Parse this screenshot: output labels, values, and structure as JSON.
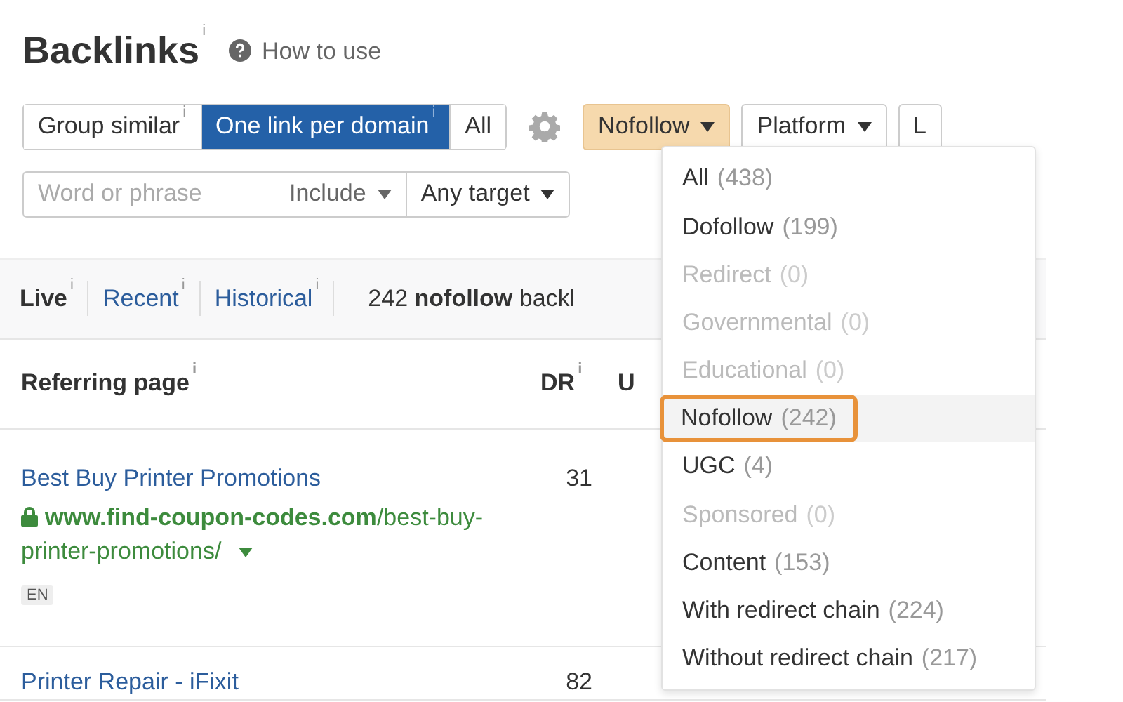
{
  "header": {
    "title": "Backlinks",
    "title_info": "i",
    "help_link": "How to use"
  },
  "mode_toggle": [
    {
      "label": "Group similar",
      "info": "i",
      "selected": false
    },
    {
      "label": "One link per domain",
      "info": "i",
      "selected": true
    },
    {
      "label": "All",
      "selected": false
    }
  ],
  "filters": [
    {
      "label": "Nofollow",
      "active": true
    },
    {
      "label": "Platform",
      "active": false
    },
    {
      "label": "L",
      "active": false
    }
  ],
  "search": {
    "placeholder": "Word or phrase",
    "mode": "Include",
    "target": "Any target"
  },
  "history_tabs": [
    {
      "label": "Live",
      "info": "i",
      "selected": true
    },
    {
      "label": "Recent",
      "info": "i",
      "selected": false
    },
    {
      "label": "Historical",
      "info": "i",
      "selected": false
    }
  ],
  "summary": "242 **nofollow** backl",
  "table": {
    "columns": [
      {
        "label": "Referring page",
        "info": "i"
      },
      {
        "label": "DR",
        "info": "i"
      },
      {
        "label": "U"
      }
    ],
    "rows": [
      {
        "title": "Best Buy Printer Promotions",
        "url": "**www.find-coupon-codes.com**/best-buy-printer-promotions/",
        "secure": true,
        "language": "EN",
        "dr": "31"
      },
      {
        "title": "Printer Repair - iFixit",
        "dr": "82"
      }
    ]
  },
  "dropdown": {
    "items": [
      {
        "label": "All",
        "count": "(438)",
        "disabled": false,
        "selected": false
      },
      {
        "label": "Dofollow",
        "count": "(199)",
        "disabled": false,
        "selected": false
      },
      {
        "label": "Redirect",
        "count": "(0)",
        "disabled": true,
        "selected": false
      },
      {
        "label": "Governmental",
        "count": "(0)",
        "disabled": true,
        "selected": false
      },
      {
        "label": "Educational",
        "count": "(0)",
        "disabled": true,
        "selected": false
      },
      {
        "label": "Nofollow",
        "count": "(242)",
        "disabled": false,
        "selected": true
      },
      {
        "label": "UGC",
        "count": "(4)",
        "disabled": false,
        "selected": false
      },
      {
        "label": "Sponsored",
        "count": "(0)",
        "disabled": true,
        "selected": false
      },
      {
        "label": "Content",
        "count": "(153)",
        "disabled": false,
        "selected": false
      },
      {
        "label": "With redirect chain",
        "count": "(224)",
        "disabled": false,
        "selected": false
      },
      {
        "label": "Without redirect chain",
        "count": "(217)",
        "disabled": false,
        "selected": false
      }
    ]
  }
}
